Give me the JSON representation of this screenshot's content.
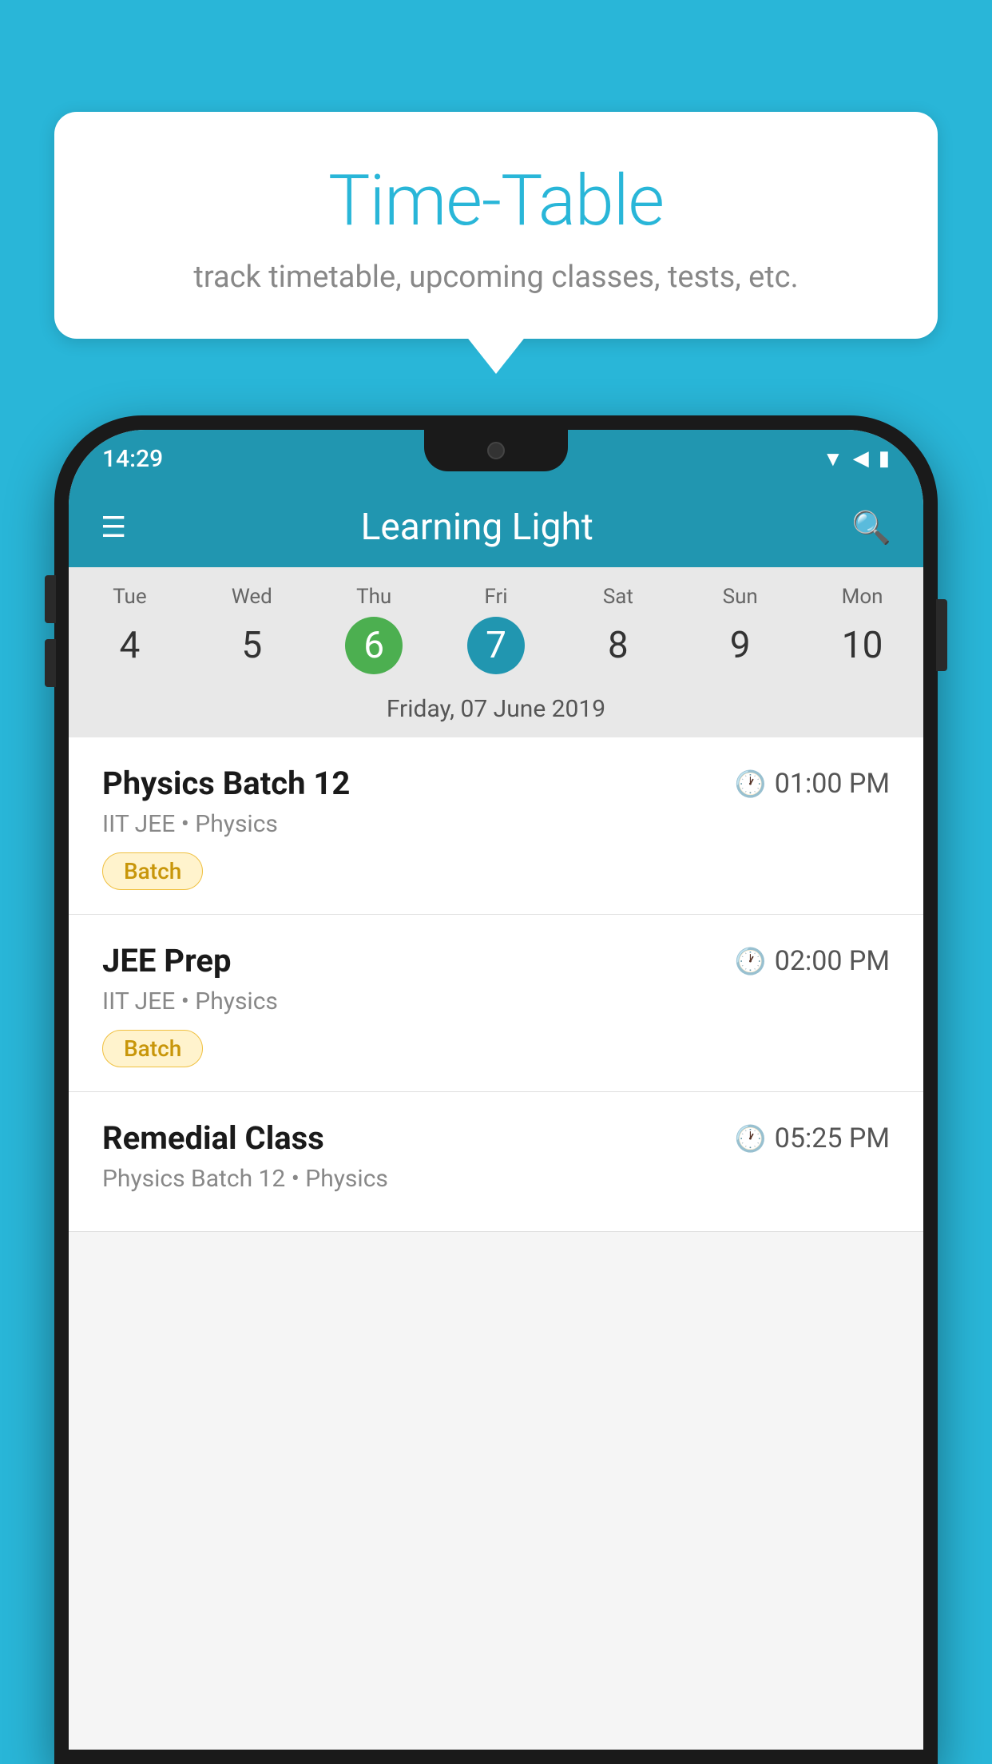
{
  "background_color": "#29b6d8",
  "tooltip": {
    "title": "Time-Table",
    "subtitle": "track timetable, upcoming classes, tests, etc."
  },
  "phone": {
    "status_bar": {
      "time": "14:29"
    },
    "app_bar": {
      "title": "Learning Light"
    },
    "calendar": {
      "days": [
        {
          "name": "Tue",
          "num": "4",
          "state": "normal"
        },
        {
          "name": "Wed",
          "num": "5",
          "state": "normal"
        },
        {
          "name": "Thu",
          "num": "6",
          "state": "today"
        },
        {
          "name": "Fri",
          "num": "7",
          "state": "selected"
        },
        {
          "name": "Sat",
          "num": "8",
          "state": "normal"
        },
        {
          "name": "Sun",
          "num": "9",
          "state": "normal"
        },
        {
          "name": "Mon",
          "num": "10",
          "state": "normal"
        }
      ],
      "selected_date_label": "Friday, 07 June 2019"
    },
    "classes": [
      {
        "name": "Physics Batch 12",
        "time": "01:00 PM",
        "subtitle": "IIT JEE • Physics",
        "badge": "Batch"
      },
      {
        "name": "JEE Prep",
        "time": "02:00 PM",
        "subtitle": "IIT JEE • Physics",
        "badge": "Batch"
      },
      {
        "name": "Remedial Class",
        "time": "05:25 PM",
        "subtitle": "Physics Batch 12 • Physics",
        "badge": null
      }
    ]
  }
}
